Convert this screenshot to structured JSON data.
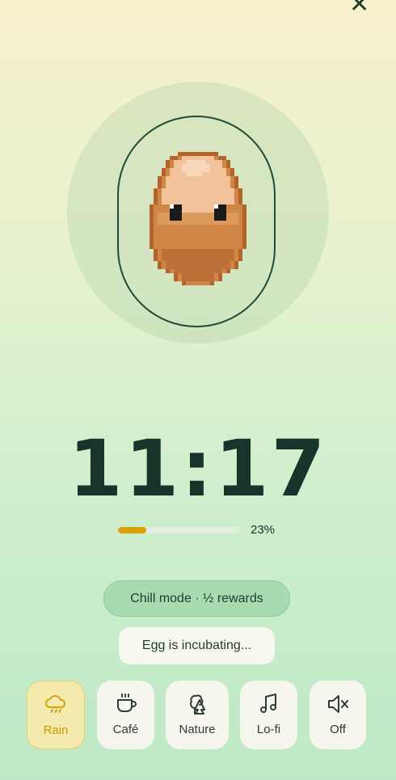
{
  "timer": {
    "display": "11:17"
  },
  "progress": {
    "percent": 23,
    "label": "23%",
    "fill_color": "#d9a308"
  },
  "mode_badge": {
    "label": "Chill mode · ½ rewards"
  },
  "status": {
    "label": "Egg is incubating..."
  },
  "sounds": [
    {
      "id": "rain",
      "label": "Rain",
      "icon": "rain-cloud-icon",
      "active": true
    },
    {
      "id": "cafe",
      "label": "Café",
      "icon": "coffee-cup-icon",
      "active": false
    },
    {
      "id": "nature",
      "label": "Nature",
      "icon": "tree-icon",
      "active": false
    },
    {
      "id": "lofi",
      "label": "Lo-fi",
      "icon": "music-note-icon",
      "active": false
    },
    {
      "id": "off",
      "label": "Off",
      "icon": "mute-icon",
      "active": false
    }
  ],
  "colors": {
    "accent": "#d9a308",
    "dark": "#16342a",
    "chip_green": "#a8dcb0"
  }
}
